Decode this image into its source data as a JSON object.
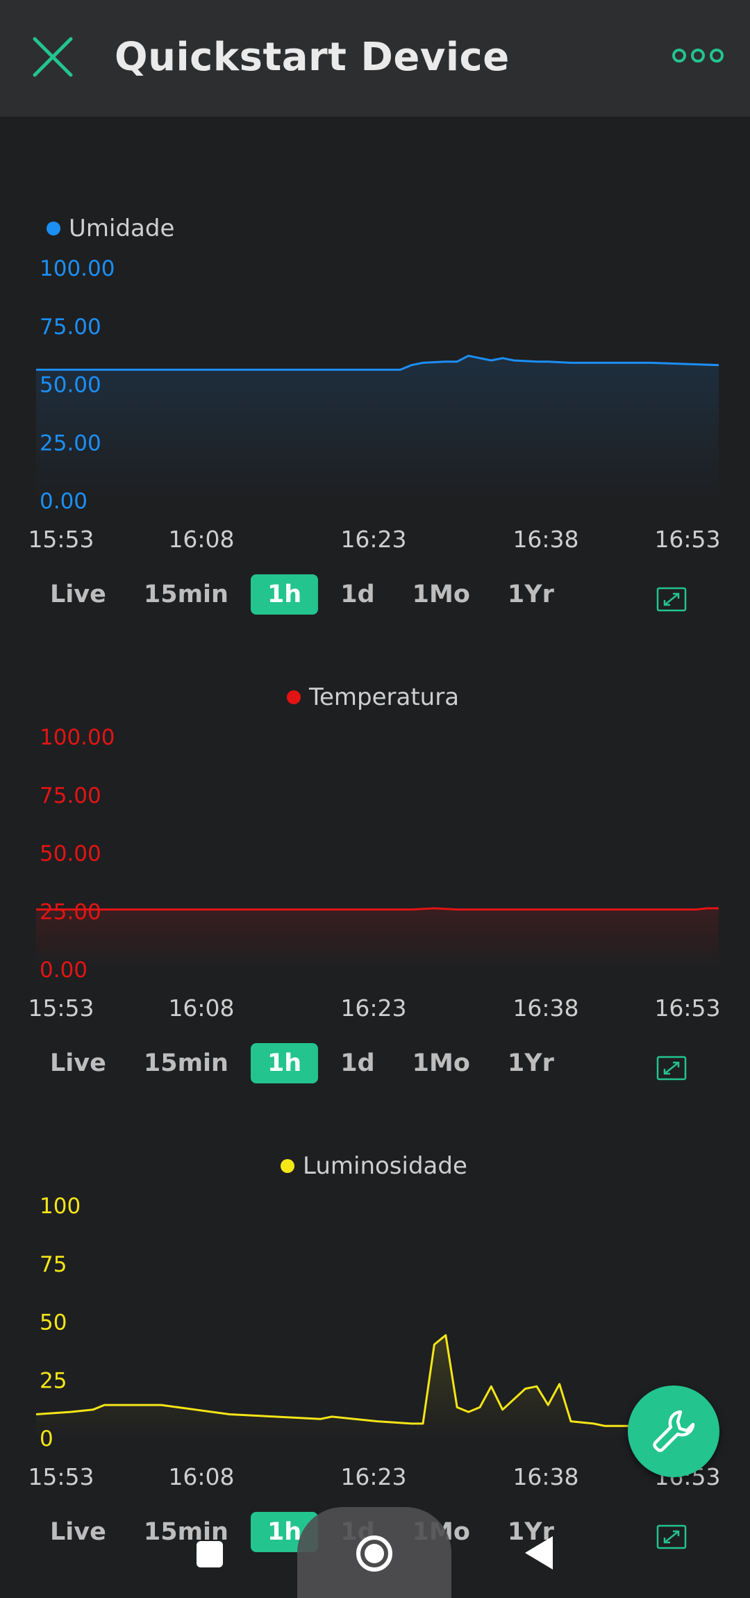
{
  "header": {
    "title": "Quickstart Device",
    "close_icon": "close-icon",
    "more_icon": "more-horizontal-icon"
  },
  "periods": [
    "Live",
    "15min",
    "1h",
    "1d",
    "1Mo",
    "1Yr"
  ],
  "active_period": "1h",
  "x_ticks": [
    "15:53",
    "16:08",
    "16:23",
    "16:38",
    "16:53"
  ],
  "colors": {
    "accent": "#23c48e",
    "umidade": "#1c8ff5",
    "temperatura": "#e31414",
    "luminosidade": "#f5e617",
    "background": "#1e1f21",
    "header": "#2d2e30"
  },
  "chart_data": [
    {
      "type": "area",
      "series": [
        {
          "name": "Umidade",
          "x": [
            0,
            8,
            16,
            24,
            32,
            33,
            34,
            36,
            37,
            38,
            39,
            40,
            41,
            42,
            44,
            45,
            47,
            49,
            50,
            52,
            54,
            60
          ],
          "values": [
            56,
            56,
            56,
            56,
            56,
            58,
            59,
            59.5,
            59.5,
            62,
            61,
            60,
            61,
            60,
            59.5,
            59.5,
            59,
            59,
            59,
            59,
            59,
            58
          ]
        }
      ],
      "y_ticks": [
        "100.00",
        "75.00",
        "50.00",
        "25.00",
        "0.00"
      ],
      "ylim": [
        0,
        100
      ],
      "xlim": [
        0,
        60
      ]
    },
    {
      "type": "area",
      "series": [
        {
          "name": "Temperatura",
          "x": [
            0,
            10,
            20,
            33,
            35,
            37,
            50,
            58,
            59,
            60
          ],
          "values": [
            25.5,
            25.5,
            25.5,
            25.5,
            26,
            25.5,
            25.5,
            25.5,
            26,
            26
          ]
        }
      ],
      "y_ticks": [
        "100.00",
        "75.00",
        "50.00",
        "25.00",
        "0.00"
      ],
      "ylim": [
        0,
        100
      ],
      "xlim": [
        0,
        60
      ]
    },
    {
      "type": "area",
      "series": [
        {
          "name": "Luminosidade",
          "x": [
            0,
            3,
            5,
            6,
            11,
            14,
            17,
            21,
            25,
            26,
            30,
            33,
            34,
            35,
            36,
            37,
            38,
            39,
            40,
            41,
            43,
            44,
            45,
            46,
            47,
            49,
            50,
            54,
            56,
            60
          ],
          "values": [
            10,
            11,
            12,
            14,
            14,
            12,
            10,
            9,
            8,
            9,
            7,
            6,
            6,
            40,
            44,
            13,
            11,
            13,
            22,
            12,
            21,
            22,
            14,
            23,
            7,
            6,
            5,
            5,
            4,
            4
          ]
        }
      ],
      "y_ticks": [
        "100",
        "75",
        "50",
        "25",
        "0"
      ],
      "ylim": [
        0,
        100
      ],
      "xlim": [
        0,
        60
      ]
    }
  ]
}
